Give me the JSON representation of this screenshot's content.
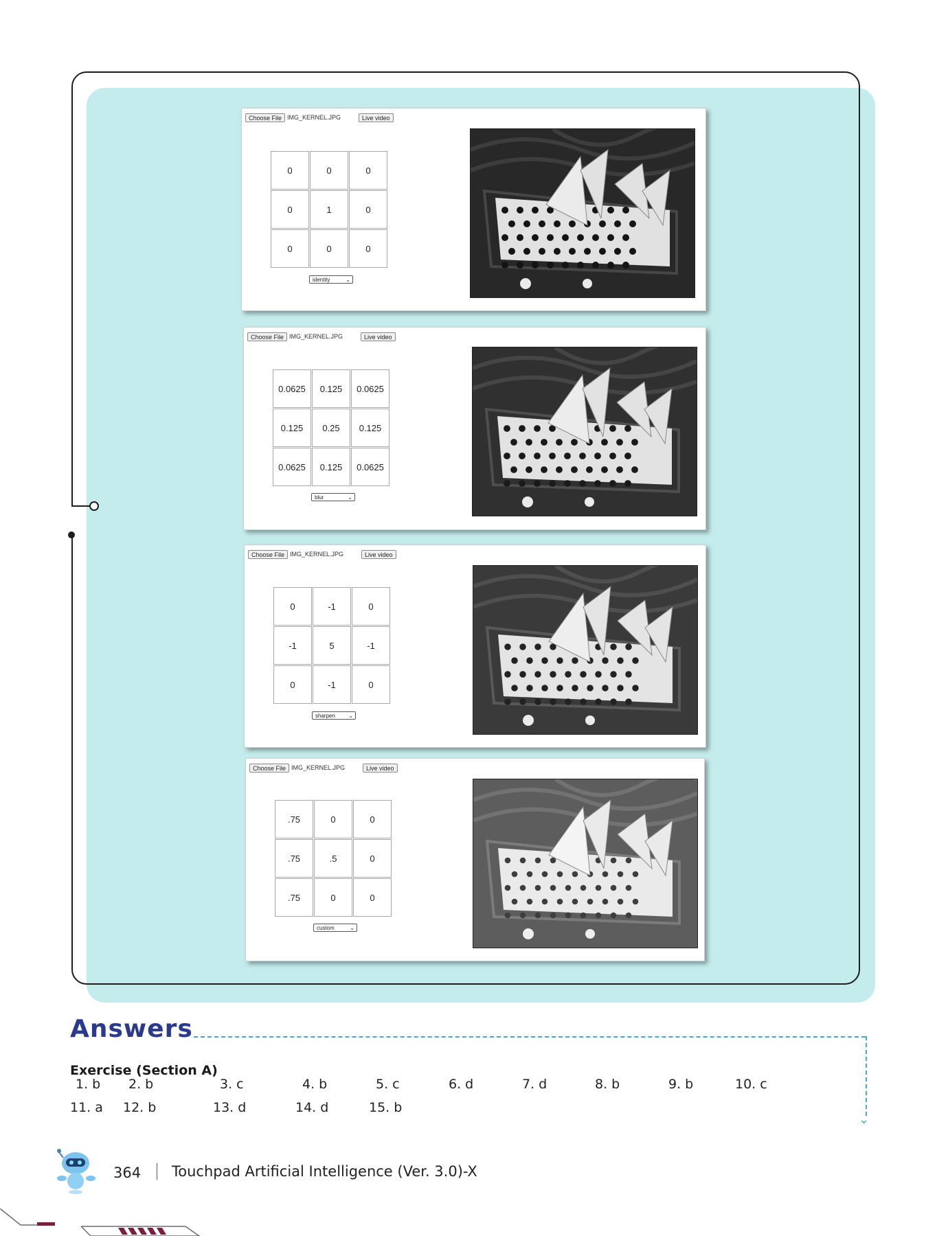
{
  "panels": [
    {
      "choose_label": "Choose File",
      "file_name": "IMG_KERNEL.JPG",
      "live_label": "Live video",
      "kernel": [
        "0",
        "0",
        "0",
        "0",
        "1",
        "0",
        "0",
        "0",
        "0"
      ],
      "filter": "identity"
    },
    {
      "choose_label": "Choose File",
      "file_name": "IMG_KERNEL.JPG",
      "live_label": "Live video",
      "kernel": [
        "0.0625",
        "0.125",
        "0.0625",
        "0.125",
        "0.25",
        "0.125",
        "0.0625",
        "0.125",
        "0.0625"
      ],
      "filter": "blur"
    },
    {
      "choose_label": "Choose File",
      "file_name": "IMG_KERNEL.JPG",
      "live_label": "Live video",
      "kernel": [
        "0",
        "-1",
        "0",
        "-1",
        "5",
        "-1",
        "0",
        "-1",
        "0"
      ],
      "filter": "sharpen"
    },
    {
      "choose_label": "Choose File",
      "file_name": "IMG_KERNEL.JPG",
      "live_label": "Live video",
      "kernel": [
        ".75",
        "0",
        "0",
        ".75",
        ".5",
        "0",
        ".75",
        "0",
        "0"
      ],
      "filter": "custom"
    }
  ],
  "answers": {
    "title": "Answers",
    "section": "Exercise (Section A)",
    "items": [
      {
        "n": "1.",
        "a": "b"
      },
      {
        "n": "2.",
        "a": "b"
      },
      {
        "n": "3.",
        "a": "c"
      },
      {
        "n": "4.",
        "a": "b"
      },
      {
        "n": "5.",
        "a": "c"
      },
      {
        "n": "6.",
        "a": "d"
      },
      {
        "n": "7.",
        "a": "d"
      },
      {
        "n": "8.",
        "a": "b"
      },
      {
        "n": "9.",
        "a": "b"
      },
      {
        "n": "10.",
        "a": "c"
      },
      {
        "n": "11.",
        "a": "a"
      },
      {
        "n": "12.",
        "a": "b"
      },
      {
        "n": "13.",
        "a": "d"
      },
      {
        "n": "14.",
        "a": "d"
      },
      {
        "n": "15.",
        "a": "b"
      }
    ]
  },
  "footer": {
    "page_number": "364",
    "book_title": "Touchpad Artificial Intelligence (Ver. 3.0)-X"
  },
  "icons": [
    "chevron-down-icon",
    "robot-mascot-icon"
  ],
  "colors": {
    "teal_background": "#c5ecec",
    "title_blue": "#2b3a8c",
    "dash_blue": "#4aa6c8",
    "stripe_maroon": "#7a1f3d"
  }
}
